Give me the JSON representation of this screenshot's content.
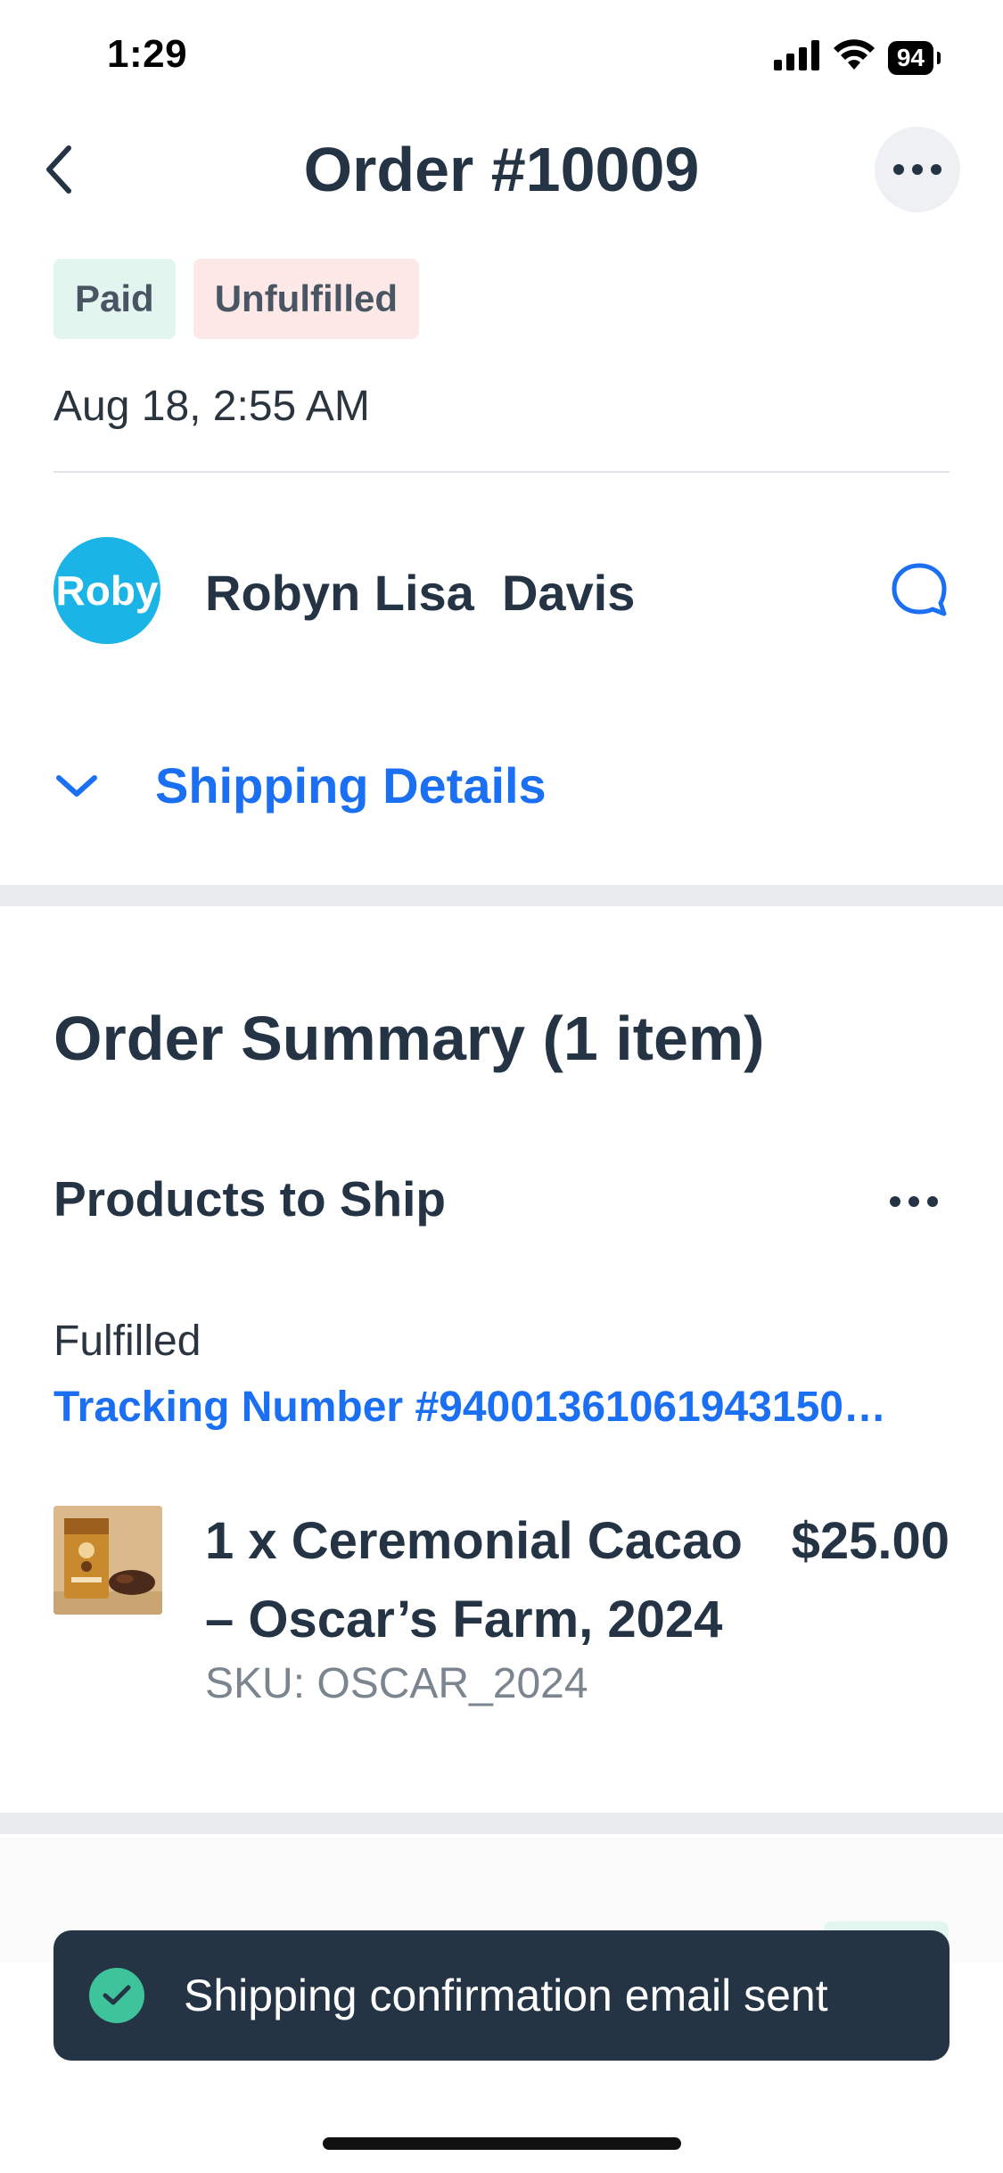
{
  "status_bar": {
    "time": "1:29",
    "battery": "94"
  },
  "header": {
    "title": "Order #10009",
    "back_icon": "chevron-left-icon",
    "more_icon": "more-horizontal-icon"
  },
  "badges": {
    "payment": "Paid",
    "fulfillment": "Unfulfilled"
  },
  "order_date": "Aug 18, 2:55 AM",
  "customer": {
    "avatar_text": "Roby",
    "name": "Robyn Lisa  Davis",
    "chat_icon": "chat-bubble-icon"
  },
  "shipping_details": {
    "label": "Shipping Details",
    "icon": "chevron-down-icon"
  },
  "order_summary": {
    "title": "Order Summary (1 item)",
    "products_title": "Products to Ship",
    "fulfilled_label": "Fulfilled",
    "tracking_text": "Tracking Number #94001361061943150…",
    "items": [
      {
        "name": "1 x Ceremonial Cacao – Oscar’s Farm, 2024",
        "price": "$25.00",
        "sku": "SKU: OSCAR_2024"
      }
    ]
  },
  "toast": {
    "message": "Shipping confirmation email sent",
    "icon": "check-circle-icon"
  },
  "colors": {
    "accent_blue": "#1b6ff2",
    "text_dark": "#253444",
    "paid_bg": "#e2f5ef",
    "unfulfilled_bg": "#fde8e8",
    "avatar_bg": "#1ab4e7",
    "toast_bg": "#253444",
    "success_green": "#3fc39a"
  }
}
